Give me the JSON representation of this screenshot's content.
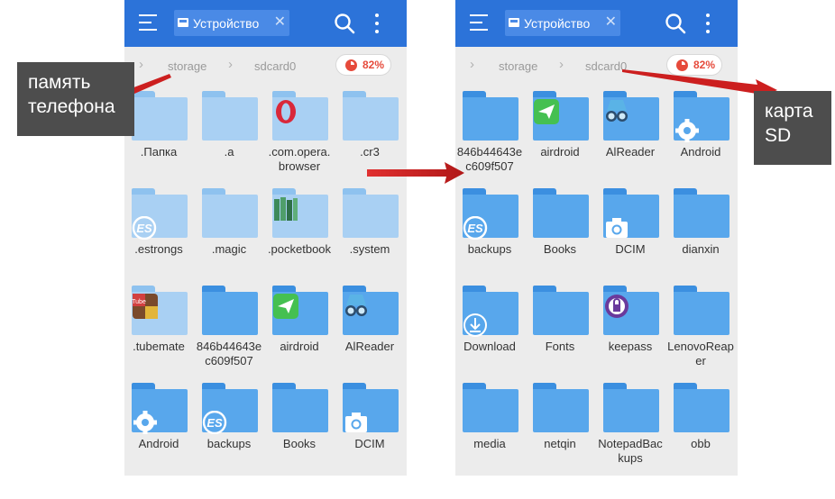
{
  "colors": {
    "topbar": "#2c73d9",
    "folder": "#58a7ec",
    "folder_hidden": "#a9d0f3",
    "usage": "#e64a3b",
    "callout": "#4d4d4d",
    "arrow": "#cc1f1f"
  },
  "callouts": {
    "phone_memory": "память телефона",
    "sd_card": "карта SD"
  },
  "left_pane": {
    "tab_label": "Устройство",
    "breadcrumb": [
      "storage",
      "sdcard0"
    ],
    "usage": "82%",
    "items": [
      {
        "name": ".Папка",
        "hidden": true,
        "badge": ""
      },
      {
        "name": ".a",
        "hidden": true,
        "badge": ""
      },
      {
        "name": ".com.opera.browser",
        "hidden": true,
        "badge": "opera-icon"
      },
      {
        "name": ".cr3",
        "hidden": true,
        "badge": ""
      },
      {
        "name": ".estrongs",
        "hidden": true,
        "badge": "es-icon"
      },
      {
        "name": ".magic",
        "hidden": true,
        "badge": ""
      },
      {
        "name": ".pocketbook",
        "hidden": true,
        "badge": "books-icon"
      },
      {
        "name": ".system",
        "hidden": true,
        "badge": ""
      },
      {
        "name": ".tubemate",
        "hidden": true,
        "badge": "tubemate-icon"
      },
      {
        "name": "846b44643ec609f507",
        "hidden": false,
        "badge": ""
      },
      {
        "name": "airdroid",
        "hidden": false,
        "badge": "airdroid-icon"
      },
      {
        "name": "AlReader",
        "hidden": false,
        "badge": "alreader-icon"
      },
      {
        "name": "Android",
        "hidden": false,
        "badge": "gear-icon"
      },
      {
        "name": "backups",
        "hidden": false,
        "badge": "es-icon"
      },
      {
        "name": "Books",
        "hidden": false,
        "badge": ""
      },
      {
        "name": "DCIM",
        "hidden": false,
        "badge": "camera-icon"
      }
    ]
  },
  "right_pane": {
    "tab_label": "Устройство",
    "breadcrumb": [
      "storage",
      "sdcard0"
    ],
    "usage": "82%",
    "items": [
      {
        "name": "846b44643ec609f507",
        "hidden": false,
        "badge": ""
      },
      {
        "name": "airdroid",
        "hidden": false,
        "badge": "airdroid-icon"
      },
      {
        "name": "AlReader",
        "hidden": false,
        "badge": "alreader-icon"
      },
      {
        "name": "Android",
        "hidden": false,
        "badge": "gear-icon"
      },
      {
        "name": "backups",
        "hidden": false,
        "badge": "es-icon"
      },
      {
        "name": "Books",
        "hidden": false,
        "badge": ""
      },
      {
        "name": "DCIM",
        "hidden": false,
        "badge": "camera-icon"
      },
      {
        "name": "dianxin",
        "hidden": false,
        "badge": ""
      },
      {
        "name": "Download",
        "hidden": false,
        "badge": "download-icon"
      },
      {
        "name": "Fonts",
        "hidden": false,
        "badge": ""
      },
      {
        "name": "keepass",
        "hidden": false,
        "badge": "keepass-icon"
      },
      {
        "name": "LenovoReaper",
        "hidden": false,
        "badge": ""
      },
      {
        "name": "media",
        "hidden": false,
        "badge": ""
      },
      {
        "name": "netqin",
        "hidden": false,
        "badge": ""
      },
      {
        "name": "NotepadBackups",
        "hidden": false,
        "badge": ""
      },
      {
        "name": "obb",
        "hidden": false,
        "badge": ""
      }
    ]
  }
}
